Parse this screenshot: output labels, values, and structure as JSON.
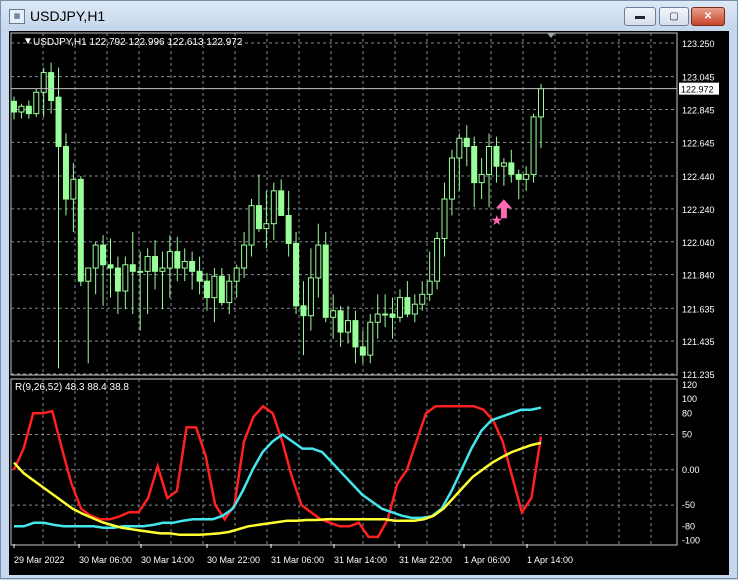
{
  "window": {
    "title": "USDJPY,H1",
    "icon": "chart-window-icon",
    "controls": [
      "minimize-icon",
      "maximize-icon",
      "close-icon"
    ],
    "control_glyphs": {
      "minimize": "▬",
      "maximize": "▢",
      "close": "✕"
    }
  },
  "chart_data": [
    {
      "type": "candlestick",
      "header": {
        "label": "USDJPY,H1",
        "values": "122.792 122.996 122.613 122.972"
      },
      "current_price": "122.972",
      "ylim": [
        121.235,
        123.25
      ],
      "price_ticks": [
        "123.250",
        "123.045",
        "122.845",
        "122.645",
        "122.440",
        "122.240",
        "122.040",
        "121.840",
        "121.635",
        "121.435",
        "121.235"
      ],
      "grid": true,
      "colors": {
        "background": "#000000",
        "candle": "#99ff99",
        "grid": "#7f8a96",
        "axis_text": "#ffffff",
        "marker": "#ff69b4"
      },
      "candles": [
        [
          122.895,
          122.924,
          122.785,
          122.83
        ],
        [
          122.83,
          122.88,
          122.79,
          122.865
        ],
        [
          122.865,
          122.9,
          122.79,
          122.82
        ],
        [
          122.82,
          122.97,
          122.8,
          122.95
        ],
        [
          122.95,
          123.1,
          122.8,
          123.07
        ],
        [
          123.07,
          123.13,
          122.82,
          122.9
        ],
        [
          122.92,
          123.1,
          121.27,
          122.62
        ],
        [
          122.62,
          122.7,
          122.2,
          122.3
        ],
        [
          122.3,
          122.52,
          122.1,
          122.42
        ],
        [
          122.42,
          122.44,
          121.77,
          121.8
        ],
        [
          121.8,
          121.88,
          121.3,
          121.88
        ],
        [
          121.88,
          122.04,
          121.72,
          122.02
        ],
        [
          122.02,
          122.08,
          121.65,
          121.9
        ],
        [
          121.9,
          122.06,
          121.7,
          121.88
        ],
        [
          121.88,
          121.95,
          121.6,
          121.74
        ],
        [
          121.74,
          121.95,
          121.63,
          121.9
        ],
        [
          121.9,
          122.1,
          121.6,
          121.86
        ],
        [
          121.86,
          121.98,
          121.5,
          121.86
        ],
        [
          121.86,
          122,
          121.6,
          121.95
        ],
        [
          121.95,
          122.05,
          121.75,
          121.86
        ],
        [
          121.86,
          121.98,
          121.63,
          121.88
        ],
        [
          121.88,
          122.08,
          121.7,
          121.98
        ],
        [
          121.98,
          122.07,
          121.8,
          121.88
        ],
        [
          121.88,
          122,
          121.8,
          121.92
        ],
        [
          121.92,
          121.98,
          121.75,
          121.86
        ],
        [
          121.86,
          121.95,
          121.72,
          121.8
        ],
        [
          121.8,
          121.85,
          121.62,
          121.7
        ],
        [
          121.7,
          121.88,
          121.55,
          121.83
        ],
        [
          121.83,
          121.88,
          121.65,
          121.67
        ],
        [
          121.67,
          121.84,
          121.6,
          121.8
        ],
        [
          121.8,
          121.9,
          121.7,
          121.88
        ],
        [
          121.88,
          122.1,
          121.82,
          122.02
        ],
        [
          122.02,
          122.3,
          121.95,
          122.26
        ],
        [
          122.26,
          122.45,
          122.1,
          122.12
        ],
        [
          122.12,
          122.35,
          122.0,
          122.15
        ],
        [
          122.15,
          122.4,
          122.05,
          122.35
        ],
        [
          122.35,
          122.42,
          122.2,
          122.2
        ],
        [
          122.2,
          122.35,
          121.95,
          122.03
        ],
        [
          122.03,
          122.1,
          121.6,
          121.65
        ],
        [
          121.65,
          121.8,
          121.35,
          121.59
        ],
        [
          121.59,
          122.0,
          121.5,
          121.82
        ],
        [
          121.82,
          122.15,
          121.7,
          122.02
        ],
        [
          122.02,
          122.1,
          121.55,
          121.58
        ],
        [
          121.58,
          121.72,
          121.45,
          121.62
        ],
        [
          121.62,
          121.65,
          121.4,
          121.49
        ],
        [
          121.49,
          121.65,
          121.42,
          121.56
        ],
        [
          121.56,
          121.62,
          121.3,
          121.4
        ],
        [
          121.4,
          121.5,
          121.3,
          121.35
        ],
        [
          121.35,
          121.6,
          121.3,
          121.55
        ],
        [
          121.55,
          121.72,
          121.45,
          121.6
        ],
        [
          121.6,
          121.72,
          121.52,
          121.6
        ],
        [
          121.6,
          121.7,
          121.45,
          121.58
        ],
        [
          121.58,
          121.75,
          121.55,
          121.7
        ],
        [
          121.7,
          121.8,
          121.58,
          121.6
        ],
        [
          121.6,
          121.72,
          121.55,
          121.66
        ],
        [
          121.66,
          121.8,
          121.62,
          121.72
        ],
        [
          121.72,
          121.98,
          121.68,
          121.8
        ],
        [
          121.8,
          122.1,
          121.75,
          122.06
        ],
        [
          122.06,
          122.4,
          121.95,
          122.3
        ],
        [
          122.3,
          122.6,
          122.2,
          122.55
        ],
        [
          122.55,
          122.7,
          122.35,
          122.67
        ],
        [
          122.67,
          122.75,
          122.5,
          122.62
        ],
        [
          122.62,
          122.68,
          122.25,
          122.4
        ],
        [
          122.4,
          122.55,
          122.3,
          122.45
        ],
        [
          122.45,
          122.7,
          122.25,
          122.62
        ],
        [
          122.62,
          122.68,
          122.4,
          122.5
        ],
        [
          122.5,
          122.55,
          122.38,
          122.52
        ],
        [
          122.52,
          122.6,
          122.4,
          122.45
        ],
        [
          122.45,
          122.48,
          122.3,
          122.42
        ],
        [
          122.42,
          122.5,
          122.35,
          122.45
        ],
        [
          122.45,
          122.82,
          122.4,
          122.8
        ],
        [
          122.8,
          123.0,
          122.61,
          122.972
        ]
      ],
      "markers": [
        {
          "kind": "buy-arrow-icon",
          "x_index": 66,
          "y": 122.22
        },
        {
          "kind": "star-icon",
          "x_index": 65,
          "y": 122.18
        }
      ]
    },
    {
      "type": "line",
      "header": {
        "label": "R(9,26,52)",
        "values": "48.3 88.4 38.8"
      },
      "ylim": [
        -105,
        120
      ],
      "y_ticks": [
        "120",
        "100",
        "80",
        "50",
        "0.00",
        "-50",
        "-80",
        "-100"
      ],
      "x_ticks": [
        "29 Mar 2022",
        "30 Mar 06:00",
        "30 Mar 14:00",
        "30 Mar 22:00",
        "31 Mar 06:00",
        "31 Mar 14:00",
        "31 Mar 22:00",
        "1 Apr 06:00",
        "1 Apr 14:00"
      ],
      "series": [
        {
          "color": "#ff2020",
          "values": [
            0,
            30,
            80,
            80,
            83,
            30,
            -20,
            -55,
            -65,
            -70,
            -70,
            -66,
            -60,
            -60,
            -40,
            5,
            -40,
            -30,
            60,
            60,
            20,
            -50,
            -70,
            -50,
            40,
            75,
            90,
            80,
            40,
            -10,
            -50,
            -60,
            -70,
            -75,
            -80,
            -80,
            -75,
            -95,
            -95,
            -70,
            -20,
            0,
            40,
            80,
            90,
            90,
            90,
            90,
            90,
            85,
            70,
            40,
            -10,
            -60,
            -40,
            47
          ]
        },
        {
          "color": "#44e6ee",
          "values": [
            -80,
            -80,
            -75,
            -75,
            -78,
            -80,
            -80,
            -80,
            -80,
            -82,
            -82,
            -80,
            -80,
            -80,
            -78,
            -75,
            -75,
            -72,
            -70,
            -70,
            -70,
            -65,
            -55,
            -30,
            0,
            25,
            40,
            50,
            40,
            30,
            30,
            25,
            10,
            -5,
            -20,
            -35,
            -45,
            -55,
            -60,
            -65,
            -68,
            -68,
            -66,
            -55,
            -30,
            0,
            30,
            55,
            70,
            75,
            80,
            85,
            85,
            88
          ]
        },
        {
          "color": "#ffff33",
          "values": [
            10,
            -5,
            -15,
            -25,
            -35,
            -45,
            -55,
            -62,
            -68,
            -74,
            -78,
            -82,
            -84,
            -86,
            -88,
            -90,
            -90,
            -92,
            -92,
            -92,
            -91,
            -90,
            -88,
            -84,
            -80,
            -78,
            -76,
            -74,
            -72,
            -72,
            -71,
            -71,
            -70,
            -70,
            -70,
            -70,
            -70,
            -70,
            -70,
            -72,
            -72,
            -72,
            -70,
            -65,
            -55,
            -40,
            -25,
            -10,
            0,
            10,
            18,
            25,
            30,
            35,
            38
          ]
        }
      ]
    }
  ]
}
